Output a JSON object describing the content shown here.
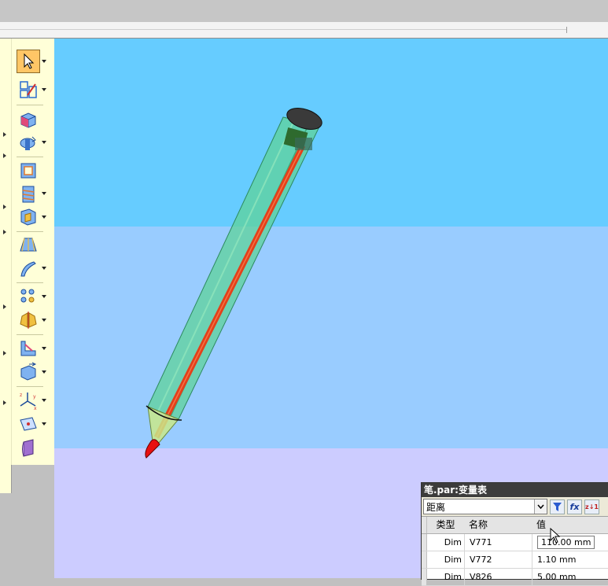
{
  "var_table": {
    "title": "笔.par:变量表",
    "filter_value": "距离",
    "buttons": {
      "filter_icon": "funnel-icon",
      "formula_label": "fx",
      "sort_label": "z↓1"
    },
    "columns": [
      "类型",
      "名称",
      "值"
    ],
    "rows": [
      {
        "type": "Dim",
        "name": "V771",
        "value": "110.00 mm",
        "editing": true
      },
      {
        "type": "Dim",
        "name": "V772",
        "value": "1.10 mm",
        "editing": false
      },
      {
        "type": "Dim",
        "name": "V826",
        "value": "5.00 mm",
        "editing": false
      }
    ]
  },
  "toolbar": {
    "tools": [
      {
        "icon": "select-arrow-icon",
        "active": true,
        "dropdown": true
      },
      {
        "icon": "sketch-plane-icon",
        "active": false,
        "dropdown": true
      },
      {
        "icon": "extrude-box-icon",
        "active": false,
        "dropdown": false
      },
      {
        "icon": "revolve-icon",
        "active": false,
        "dropdown": true
      },
      {
        "icon": "hole-frame-icon",
        "active": false,
        "dropdown": false
      },
      {
        "icon": "thread-icon",
        "active": false,
        "dropdown": true
      },
      {
        "icon": "cutout-icon",
        "active": false,
        "dropdown": true
      },
      {
        "icon": "loft-icon",
        "active": false,
        "dropdown": false
      },
      {
        "icon": "sweep-icon",
        "active": false,
        "dropdown": true
      },
      {
        "icon": "pattern-icon",
        "active": false,
        "dropdown": true
      },
      {
        "icon": "mirror-icon",
        "active": false,
        "dropdown": true
      },
      {
        "icon": "rib-icon",
        "active": false,
        "dropdown": true
      },
      {
        "icon": "shell-icon",
        "active": false,
        "dropdown": true
      },
      {
        "icon": "coordinate-system-icon",
        "active": false,
        "dropdown": true
      },
      {
        "icon": "reference-plane-icon",
        "active": false,
        "dropdown": true
      },
      {
        "icon": "surface-icon",
        "active": false,
        "dropdown": false
      }
    ]
  },
  "colors": {
    "sky_upper": "#66ccff",
    "sky_lower": "#99ccff",
    "ground": "#ccccff",
    "pen_body": "#5fd39a",
    "refill": "#e2401a",
    "cap": "#3a3a3a"
  }
}
